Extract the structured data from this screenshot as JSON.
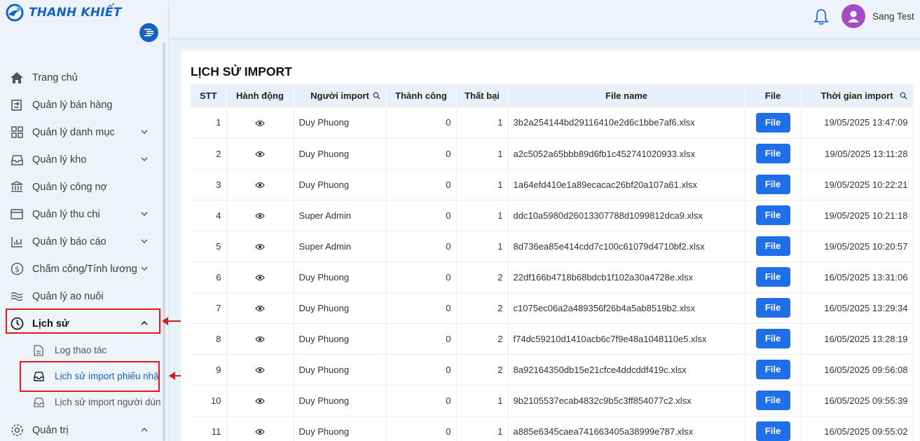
{
  "brand": {
    "name": "THANH KHIẾT"
  },
  "header": {
    "username": "Sang Test"
  },
  "menu": [
    {
      "label": "Trang chủ",
      "icon": "home-icon",
      "chev": ""
    },
    {
      "label": "Quản lý bán hàng",
      "icon": "sales-icon",
      "chev": ""
    },
    {
      "label": "Quản lý danh mục",
      "icon": "grid-icon",
      "chev": "down"
    },
    {
      "label": "Quản lý kho",
      "icon": "inbox-icon",
      "chev": "down"
    },
    {
      "label": "Quản lý công nợ",
      "icon": "bank-icon",
      "chev": ""
    },
    {
      "label": "Quản lý thu chi",
      "icon": "wallet-icon",
      "chev": "down"
    },
    {
      "label": "Quản lý báo cáo",
      "icon": "bar-chart-icon",
      "chev": "down"
    },
    {
      "label": "Chấm công/Tính lương",
      "icon": "dollar-icon",
      "chev": "down"
    },
    {
      "label": "Quản lý ao nuôi",
      "icon": "waves-icon",
      "chev": ""
    },
    {
      "label": "Lịch sử",
      "icon": "history-icon",
      "chev": "up"
    }
  ],
  "submenu": [
    {
      "label": "Log thao tác",
      "icon": "file-icon"
    },
    {
      "label": "Lịch sử import phiếu nhậ",
      "icon": "inbox-icon"
    },
    {
      "label": "Lịch sử import người dùn",
      "icon": "inbox-icon"
    }
  ],
  "menu_bottom": {
    "label": "Quản trị",
    "icon": "gear-icon"
  },
  "page": {
    "title": "LỊCH SỬ IMPORT"
  },
  "table": {
    "columns": [
      "STT",
      "Hành động",
      "Người import",
      "Thành công",
      "Thất bại",
      "File name",
      "File",
      "Thời gian import"
    ],
    "file_button": "File",
    "rows": [
      [
        "1",
        "Duy Phuong",
        "0",
        "1",
        "3b2a254144bd29116410e2d6c1bbe7af6.xlsx",
        "19/05/2025 13:47:09"
      ],
      [
        "2",
        "Duy Phuong",
        "0",
        "1",
        "a2c5052a65bbb89d6fb1c452741020933.xlsx",
        "19/05/2025 13:11:28"
      ],
      [
        "3",
        "Duy Phuong",
        "0",
        "1",
        "1a64efd410e1a89ecacac26bf20a107a61.xlsx",
        "19/05/2025 10:22:21"
      ],
      [
        "4",
        "Super Admin",
        "0",
        "1",
        "ddc10a5980d26013307788d1099812dca9.xlsx",
        "19/05/2025 10:21:18"
      ],
      [
        "5",
        "Super Admin",
        "0",
        "1",
        "8d736ea85e414cdd7c100c61079d4710bf2.xlsx",
        "19/05/2025 10:20:57"
      ],
      [
        "6",
        "Duy Phuong",
        "0",
        "2",
        "22df166b4718b68bdcb1f102a30a4728e.xlsx",
        "16/05/2025 13:31:06"
      ],
      [
        "7",
        "Duy Phuong",
        "0",
        "2",
        "c1075ec06a2a489356f26b4a5ab8519b2.xlsx",
        "16/05/2025 13:29:34"
      ],
      [
        "8",
        "Duy Phuong",
        "0",
        "2",
        "f74dc59210d1410acb6c7f9e48a1048110e5.xlsx",
        "16/05/2025 13:28:19"
      ],
      [
        "9",
        "Duy Phuong",
        "0",
        "2",
        "8a92164350db15e21cfce4ddcddf419c.xlsx",
        "16/05/2025 09:56:08"
      ],
      [
        "10",
        "Duy Phuong",
        "0",
        "1",
        "9b2105537ecab4832c9b5c3ff854077c2.xlsx",
        "16/05/2025 09:55:39"
      ],
      [
        "11",
        "Duy Phuong",
        "0",
        "1",
        "a885e6345caea741663405a38999e787.xlsx",
        "16/05/2025 09:55:02"
      ]
    ]
  },
  "colors": {
    "primary": "#1565c0",
    "button": "#1e6fe8",
    "highlight": "#e01a1a",
    "avatar": "#a64ac9"
  }
}
